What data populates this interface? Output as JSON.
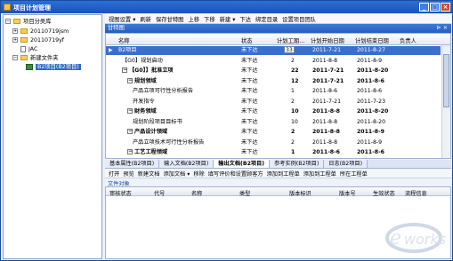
{
  "window": {
    "title": "项目计划管理",
    "min_label": "_",
    "max_label": "□",
    "close_label": "×"
  },
  "tree": {
    "root": "项目分类库",
    "nodes": [
      "20110719jsm",
      "20110719yf",
      "JAC",
      "新建文件夹"
    ],
    "selected": "B2项目(B2项目)",
    "expand_symbol": "+",
    "collapse_symbol": "−"
  },
  "menu": [
    "视图设置 ▾",
    "刷新",
    "保存甘特图",
    "上移",
    "下移",
    "新建 ▾",
    "下达",
    "绑定目录",
    "设置项目团队"
  ],
  "panel": {
    "title": "甘特图",
    "pin": "⊳ ×"
  },
  "grid": {
    "headers": [
      "名称",
      "状态",
      "计划工期...",
      "计划开始日期",
      "计划结束日期",
      "负责人"
    ],
    "rows": [
      {
        "mark": "▶",
        "name": "B2项目",
        "status": "未下达",
        "duration": "33",
        "start": "2011-7-21",
        "end": "2011-8-27",
        "bold": false,
        "level": 0,
        "selected": true,
        "expander": ""
      },
      {
        "mark": "",
        "name": "【G0】规划启动",
        "status": "未下达",
        "duration": "2",
        "start": "2011-8-8",
        "end": "2011-8-9",
        "bold": false,
        "level": 1,
        "selected": false,
        "expander": ""
      },
      {
        "mark": "",
        "name": "【G0】】批准立项",
        "status": "未下达",
        "duration": "22",
        "start": "2011-7-21",
        "end": "2011-8-20",
        "bold": true,
        "level": 1,
        "selected": false,
        "expander": "−"
      },
      {
        "mark": "",
        "name": "规划领域",
        "status": "未下达",
        "duration": "12",
        "start": "2011-7-21",
        "end": "2011-8-6",
        "bold": true,
        "level": 2,
        "selected": false,
        "expander": "−"
      },
      {
        "mark": "",
        "name": "产品立项可行性分析报告",
        "status": "未下达",
        "duration": "1",
        "start": "2011-8-6",
        "end": "2011-8-6",
        "bold": false,
        "level": 3,
        "selected": false,
        "expander": ""
      },
      {
        "mark": "",
        "name": "开发指令",
        "status": "未下达",
        "duration": "2",
        "start": "2011-7-21",
        "end": "2011-7-23",
        "bold": false,
        "level": 3,
        "selected": false,
        "expander": ""
      },
      {
        "mark": "",
        "name": "财务领域",
        "status": "未下达",
        "duration": "10",
        "start": "2011-8-8",
        "end": "2011-8-20",
        "bold": true,
        "level": 2,
        "selected": false,
        "expander": "−"
      },
      {
        "mark": "",
        "name": "规划阶段项目目标书",
        "status": "未下达",
        "duration": "10",
        "start": "2011-8-8",
        "end": "2011-8-20",
        "bold": false,
        "level": 3,
        "selected": false,
        "expander": ""
      },
      {
        "mark": "",
        "name": "产品设计领域",
        "status": "未下达",
        "duration": "2",
        "start": "2011-8-8",
        "end": "2011-8-9",
        "bold": true,
        "level": 2,
        "selected": false,
        "expander": "−"
      },
      {
        "mark": "",
        "name": "产品立项技术可行性分析报告",
        "status": "未下达",
        "duration": "2",
        "start": "2011-8-8",
        "end": "2011-8-9",
        "bold": false,
        "level": 3,
        "selected": false,
        "expander": ""
      },
      {
        "mark": "",
        "name": "工艺工程领域",
        "status": "未下达",
        "duration": "1",
        "start": "2011-8-6",
        "end": "2011-8-6",
        "bold": true,
        "level": 2,
        "selected": false,
        "expander": "−"
      }
    ]
  },
  "tabs": [
    "基本属性(B2项目)",
    "输入文档(B2项目)",
    "输出文档(B2项目)",
    "参考实例(B2项目)",
    "日志(B2项目)"
  ],
  "active_tab": 2,
  "toolbar2": [
    "打开",
    "预览",
    "新建文档",
    "添加文档 ▾",
    "移除",
    "填写评价和设置顾客方",
    "添加到工程单",
    "添加到工程单",
    "所在工程单"
  ],
  "sublabel": "文件对象",
  "doc_headers": [
    "审核状态",
    "代号",
    "名称",
    "类型",
    "版本标识",
    "版本号",
    "生效状态",
    "流程信息"
  ]
}
